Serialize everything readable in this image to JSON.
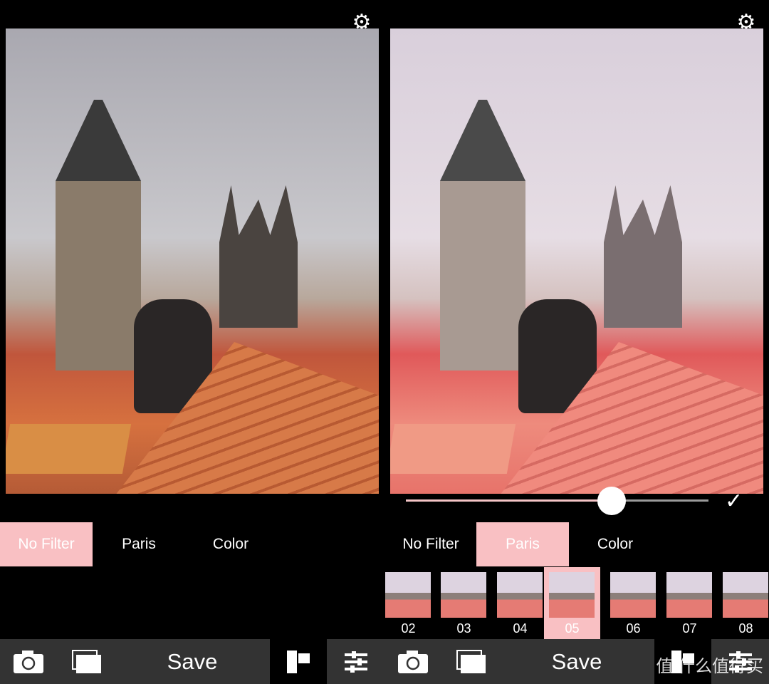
{
  "left": {
    "tabs": [
      {
        "label": "No Filter",
        "selected": true
      },
      {
        "label": "Paris",
        "selected": false
      },
      {
        "label": "Color",
        "selected": false
      }
    ],
    "toolbar": {
      "save_label": "Save",
      "active_tool": "film"
    }
  },
  "right": {
    "tabs": [
      {
        "label": "No Filter",
        "selected": false
      },
      {
        "label": "Paris",
        "selected": true
      },
      {
        "label": "Color",
        "selected": false
      }
    ],
    "intensity": 0.68,
    "filters": [
      {
        "label": "02"
      },
      {
        "label": "03"
      },
      {
        "label": "04"
      },
      {
        "label": "05",
        "selected": true
      },
      {
        "label": "06"
      },
      {
        "label": "07"
      },
      {
        "label": "08"
      }
    ],
    "toolbar": {
      "save_label": "Save"
    }
  },
  "watermark": "值 什么值得买",
  "colors": {
    "accent": "#f9c0c3",
    "toolbar": "#333333"
  }
}
